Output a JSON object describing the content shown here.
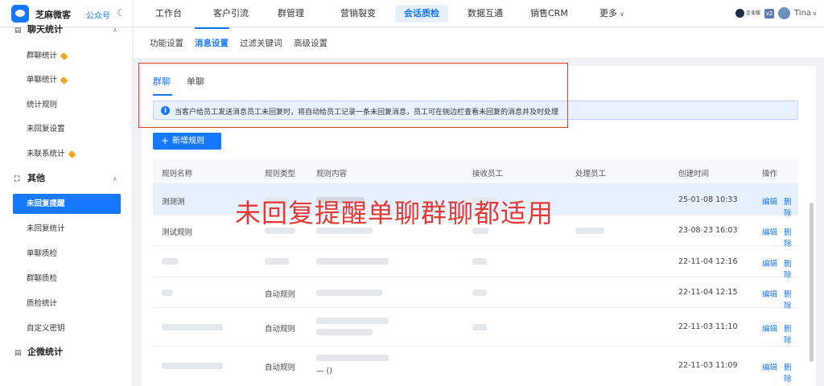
{
  "app": {
    "brand": "芝麻微客",
    "gzh": "公众号",
    "moon_icon": "moon-icon"
  },
  "topnav": {
    "items": [
      "工作台",
      "客户引流",
      "群管理",
      "营销裂变",
      "会话质检",
      "数据互通",
      "销售CRM",
      "更多"
    ],
    "active": "会话质检",
    "ent_badge": "企业版",
    "version": "v2",
    "user": "Tina"
  },
  "sidebar": {
    "sections": [
      {
        "title": "聊天统计",
        "items": [
          "群聊统计",
          "单聊统计",
          "统计规则",
          "未回复设置",
          "未联系统计"
        ]
      },
      {
        "title": "其他",
        "items": [
          "未回复提醒",
          "未回复统计",
          "单聊质检",
          "群聊质检",
          "质检统计",
          "自定义密钥"
        ]
      },
      {
        "title": "企微统计",
        "items": []
      }
    ],
    "active_item": "未回复提醒"
  },
  "subtabs": [
    "功能设置",
    "消息设置",
    "过滤关键词",
    "高级设置"
  ],
  "active_subtab": "消息设置",
  "rule_tabs": [
    "群聊",
    "单聊"
  ],
  "active_rule_tab": "群聊",
  "alert": "当客户给员工发送消息员工未回复时，将自动给员工记录一条未回复消息，员工可在侧边栏查看未回复的消息并及时处理",
  "add_button": "新增规则",
  "table": {
    "columns": [
      "规则名称",
      "规则类型",
      "规则内容",
      "接收员工",
      "处理员工",
      "创建时间",
      "操作"
    ],
    "rows": [
      {
        "name": "测测测",
        "type": "",
        "content": "",
        "created": "25-01-08 10:33"
      },
      {
        "name": "测试规则",
        "type": "",
        "content": "",
        "created": "23-08-23 16:03"
      },
      {
        "name": "",
        "type": "",
        "content": "",
        "created": "22-11-04 12:16"
      },
      {
        "name": "",
        "type": "自动规则",
        "content": "",
        "created": "22-11-04 12:15"
      },
      {
        "name": "",
        "type": "自动规则",
        "content": "",
        "created": "22-11-03 11:10"
      },
      {
        "name": "",
        "type": "自动规则",
        "content": "— ()",
        "created": "22-11-03 11:09"
      }
    ],
    "op_edit": "编辑",
    "op_delete": "删除"
  },
  "overlay_text": "未回复提醒单聊群聊都适用",
  "colors": {
    "accent": "#1677ff",
    "annotation": "#e53935",
    "gem": "#f5a623"
  }
}
